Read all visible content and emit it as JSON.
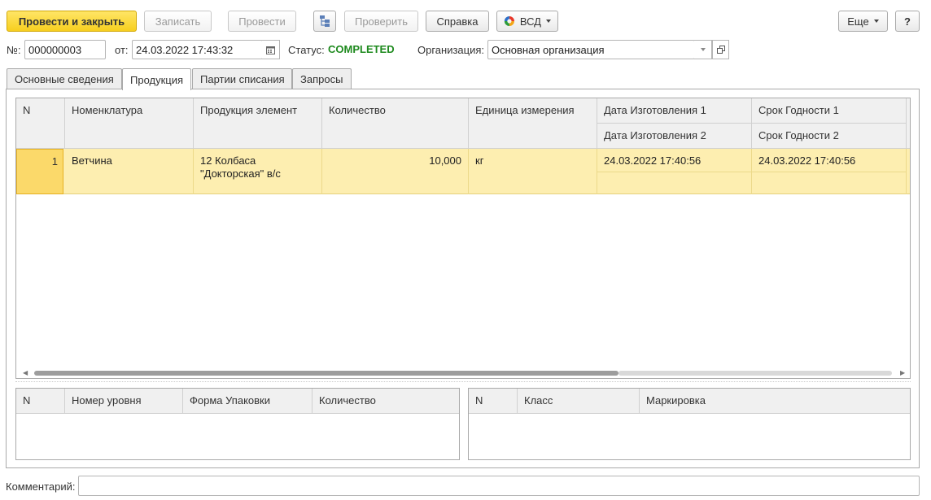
{
  "toolbar": {
    "post_close": "Провести и закрыть",
    "write": "Записать",
    "post": "Провести",
    "check": "Проверить",
    "help": "Справка",
    "vsd": "ВСД",
    "more": "Еще",
    "question": "?"
  },
  "header": {
    "number_label": "№:",
    "number_value": "000000003",
    "date_label": "от:",
    "date_value": "24.03.2022 17:43:32",
    "status_label": "Статус:",
    "status_value": "COMPLETED",
    "org_label": "Организация:",
    "org_value": "Основная организация"
  },
  "tabs": [
    {
      "label": "Основные сведения"
    },
    {
      "label": "Продукция"
    },
    {
      "label": "Партии списания"
    },
    {
      "label": "Запросы"
    }
  ],
  "products_table": {
    "columns": {
      "n": "N",
      "nomenclature": "Номенклатура",
      "product_element": "Продукция элемент",
      "quantity": "Количество",
      "unit": "Единица измерения",
      "mfg_date_1": "Дата Изготовления 1",
      "mfg_date_2": "Дата Изготовления 2",
      "expiry_1": "Срок Годности 1",
      "expiry_2": "Срок Годности 2"
    },
    "rows": [
      {
        "n": "1",
        "nomenclature": "Ветчина",
        "product_element_line1": "12 Колбаса",
        "product_element_line2": "\"Докторская\" в/с",
        "quantity": "10,000",
        "unit": "кг",
        "mfg_date_1": "24.03.2022 17:40:56",
        "expiry_1": "24.03.2022 17:40:56"
      }
    ]
  },
  "packaging_table": {
    "columns": {
      "n": "N",
      "level": "Номер уровня",
      "form": "Форма Упаковки",
      "quantity": "Количество"
    }
  },
  "marking_table": {
    "columns": {
      "n": "N",
      "class": "Класс",
      "marking": "Маркировка"
    }
  },
  "footer": {
    "comment_label": "Комментарий:",
    "comment_value": ""
  },
  "colors": {
    "primary_button": "#f7cf1f",
    "selected_row": "#fdeeb0",
    "status": "#1e8a1e"
  }
}
